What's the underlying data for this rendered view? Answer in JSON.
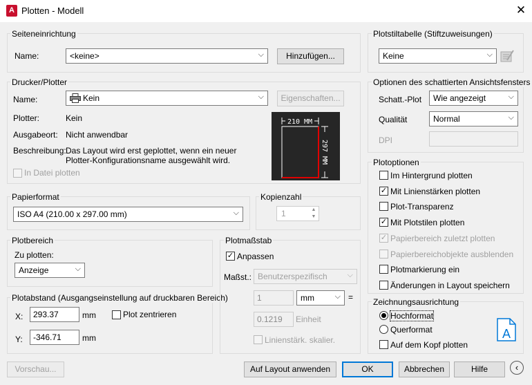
{
  "window": {
    "title": "Plotten - Modell",
    "app_icon_glyph": "A"
  },
  "page_setup": {
    "group_label": "Seiteneinrichtung",
    "name_label": "Name:",
    "name_value": "<keine>",
    "add_button": "Hinzufügen..."
  },
  "printer": {
    "group_label": "Drucker/Plotter",
    "name_label": "Name:",
    "name_value": "Kein",
    "properties_button": "Eigenschaften...",
    "plotter_label": "Plotter:",
    "plotter_value": "Kein",
    "location_label": "Ausgabeort:",
    "location_value": "Nicht anwendbar",
    "description_label": "Beschreibung:",
    "description_line1": "Das Layout wird erst geplottet, wenn ein neuer",
    "description_line2": "Plotter-Konfigurationsname ausgewählt wird.",
    "plot_to_file": "In Datei plotten",
    "preview_width": "210 MM",
    "preview_height": "297 MM"
  },
  "paper_size": {
    "group_label": "Papierformat",
    "value": "ISO A4 (210.00 x 297.00 mm)"
  },
  "copies": {
    "group_label": "Kopienzahl",
    "value": "1"
  },
  "plot_area": {
    "group_label": "Plotbereich",
    "what_label": "Zu plotten:",
    "what_value": "Anzeige"
  },
  "plot_offset": {
    "group_label": "Plotabstand (Ausgangseinstellung auf druckbaren Bereich)",
    "x_label": "X:",
    "x_value": "293.37",
    "x_unit": "mm",
    "y_label": "Y:",
    "y_value": "-346.71",
    "y_unit": "mm",
    "center_plot": "Plot zentrieren"
  },
  "plot_scale": {
    "group_label": "Plotmaßstab",
    "fit_to_paper": "Anpassen",
    "scale_label": "Maßst.:",
    "scale_value": "Benutzerspezifisch",
    "value1": "1",
    "unit_value": "mm",
    "equals": "=",
    "value2": "0.1219",
    "unit2": "Einheit",
    "scale_lineweights": "Linienstärk. skalier."
  },
  "plot_style": {
    "group_label": "Plotstiltabelle (Stiftzuweisungen)",
    "value": "Keine"
  },
  "shaded": {
    "group_label": "Optionen des schattierten Ansichtsfensters",
    "shade_label": "Schatt.-Plot",
    "shade_value": "Wie angezeigt",
    "quality_label": "Qualität",
    "quality_value": "Normal",
    "dpi_label": "DPI"
  },
  "plot_options": {
    "group_label": "Plotoptionen",
    "items": [
      {
        "label": "Im Hintergrund plotten",
        "checked": false,
        "disabled": false
      },
      {
        "label": "Mit Linienstärken plotten",
        "checked": true,
        "disabled": false
      },
      {
        "label": "Plot-Transparenz",
        "checked": false,
        "disabled": false
      },
      {
        "label": "Mit Plotstilen plotten",
        "checked": true,
        "disabled": false
      },
      {
        "label": "Papierbereich zuletzt plotten",
        "checked": true,
        "disabled": true
      },
      {
        "label": "Papierbereichobjekte ausblenden",
        "checked": false,
        "disabled": true
      },
      {
        "label": "Plotmarkierung ein",
        "checked": false,
        "disabled": false
      },
      {
        "label": "Änderungen in Layout speichern",
        "checked": false,
        "disabled": false
      }
    ]
  },
  "orientation": {
    "group_label": "Zeichnungsausrichtung",
    "portrait": "Hochformat",
    "landscape": "Querformat",
    "upside_down": "Auf dem Kopf plotten"
  },
  "footer": {
    "preview": "Vorschau...",
    "apply_layout": "Auf Layout anwenden",
    "ok": "OK",
    "cancel": "Abbrechen",
    "help": "Hilfe"
  },
  "colors": {
    "accent": "#0078d7",
    "autocad_red": "#c8102e",
    "paper_edge_red": "#e00000"
  }
}
